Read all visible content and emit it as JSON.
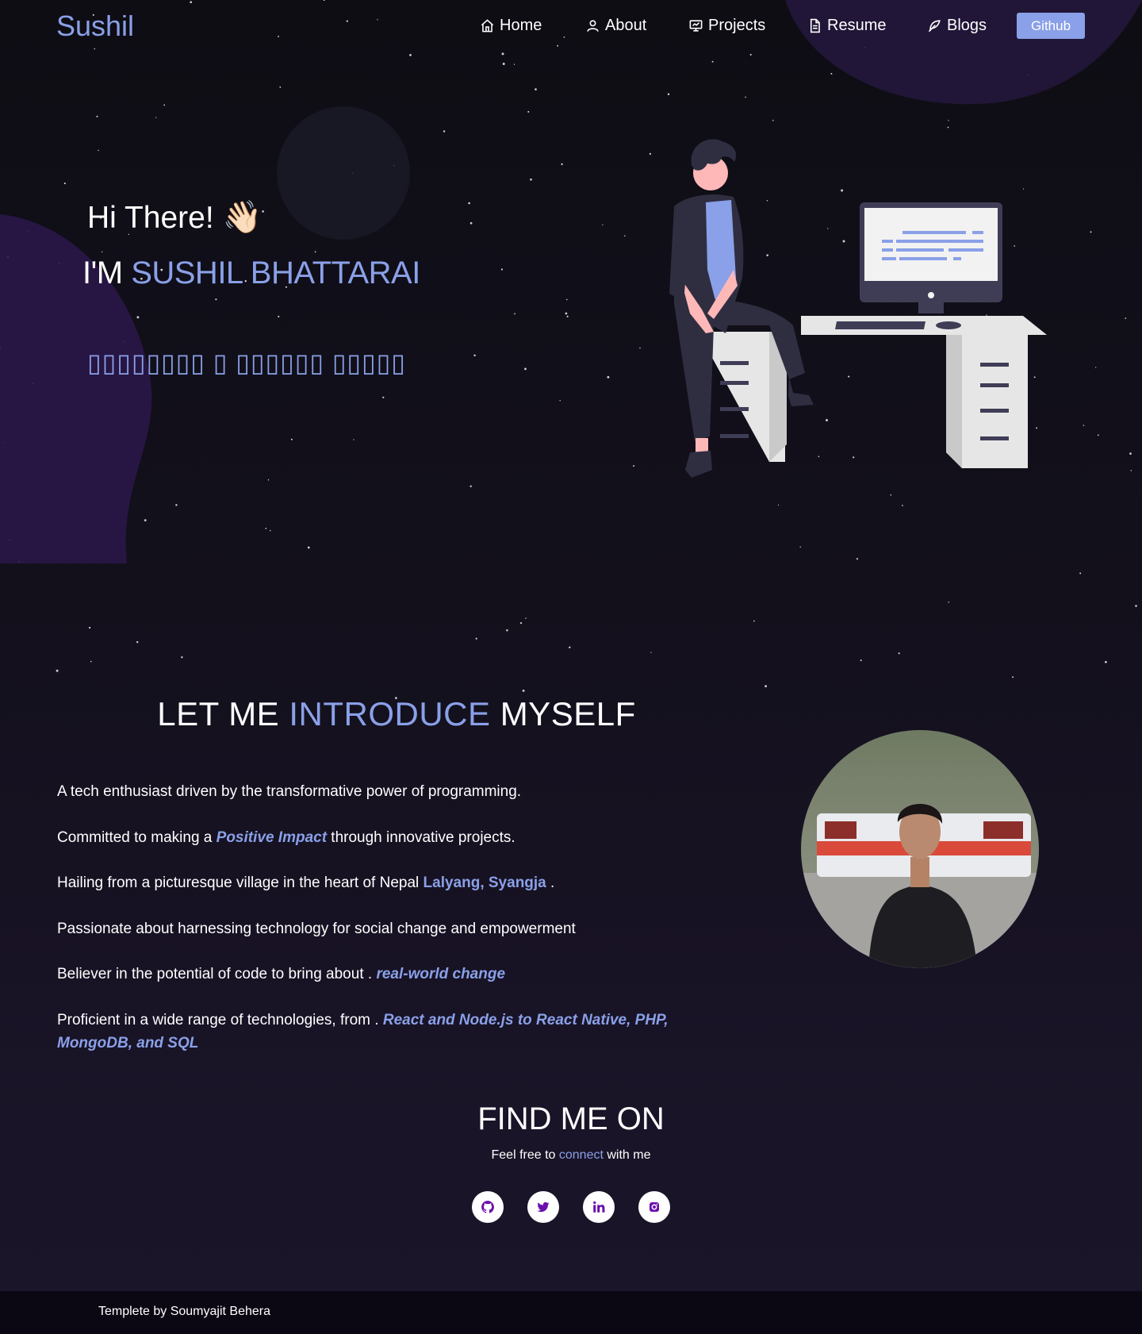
{
  "navbar": {
    "brand": "Sushil",
    "items": [
      {
        "label": "Home",
        "icon": "home-icon"
      },
      {
        "label": "About",
        "icon": "user-icon"
      },
      {
        "label": "Projects",
        "icon": "presentation-icon"
      },
      {
        "label": "Resume",
        "icon": "document-icon"
      },
      {
        "label": "Blogs",
        "icon": "feather-icon"
      }
    ],
    "github_label": "Github"
  },
  "hero": {
    "greeting": "Hi There!",
    "wave": "👋🏻",
    "im_prefix": "I'M ",
    "name": "SUSHIL BHATTARAI",
    "typed_text": "▯▯▯▯▯▯▯▯ ▯ ▯▯▯▯▯▯ ▯▯▯▯▯"
  },
  "intro": {
    "title_pre": "LET ME ",
    "title_accent": "INTRODUCE",
    "title_post": " MYSELF",
    "p1": "A tech enthusiast driven by the transformative power of programming.",
    "p2_pre": "Committed to making a ",
    "p2_hl": "Positive Impact",
    "p2_post": " through innovative projects.",
    "p3_pre": "Hailing from a picturesque village in the heart of Nepal ",
    "p3_hl": "Lalyang, Syangja",
    "p3_post": " .",
    "p4": "Passionate about harnessing technology for social change and empowerment",
    "p5_pre": "Believer in the potential of code to bring about . ",
    "p5_hl": "real-world change",
    "p6_pre": "Proficient in a wide range of technologies, from . ",
    "p6_hl": "React and Node.js to React Native, PHP, MongoDB, and SQL"
  },
  "find": {
    "title": "FIND ME ON",
    "sub_pre": "Feel free to ",
    "sub_hl": "connect",
    "sub_post": " with me",
    "socials": [
      "github-icon",
      "twitter-icon",
      "linkedin-icon",
      "instagram-icon"
    ]
  },
  "footer": {
    "text": "Templete by Soumyajit Behera"
  },
  "colors": {
    "accent": "#8aa0e8",
    "background": "#0e0d14",
    "social_icon": "#6a0fae"
  }
}
